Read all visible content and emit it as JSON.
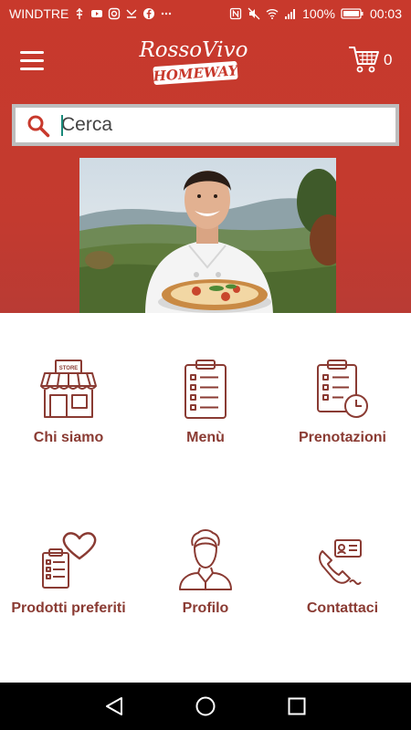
{
  "statusbar": {
    "carrier": "WINDTRE",
    "battery": "100%",
    "time": "00:03"
  },
  "header": {
    "logo_line1": "RossoVivo",
    "logo_line2": "HOMEWAY",
    "cart_count": "0"
  },
  "search": {
    "placeholder": "Cerca"
  },
  "menu": {
    "items": [
      {
        "label": "Chi siamo",
        "icon": "store-icon"
      },
      {
        "label": "Menù",
        "icon": "menu-clipboard-icon"
      },
      {
        "label": "Prenotazioni",
        "icon": "reservation-clock-icon"
      },
      {
        "label": "Prodotti preferiti",
        "icon": "favorite-heart-icon"
      },
      {
        "label": "Profilo",
        "icon": "chef-profile-icon"
      },
      {
        "label": "Contattaci",
        "icon": "contact-phone-icon"
      }
    ]
  },
  "colors": {
    "brand_red": "#c8392c",
    "icon_red": "#8a3b33"
  }
}
